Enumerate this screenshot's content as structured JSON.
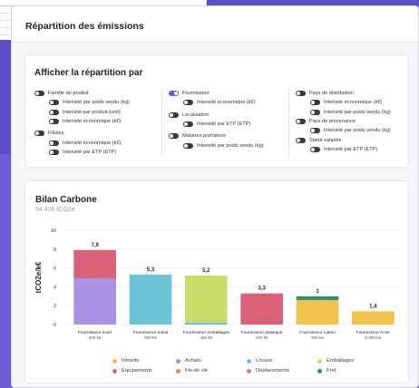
{
  "panel": {
    "title": "Répartition des émissions"
  },
  "filters": {
    "title": "Afficher la répartition par",
    "columns": [
      [
        {
          "label": "Famille de produit",
          "sub": false,
          "on": false
        },
        {
          "label": "Intensité par poids vendu (kg)",
          "sub": true,
          "on": false
        },
        {
          "label": "Intensité par produit (unit)",
          "sub": true,
          "on": false
        },
        {
          "label": "Intensité économique (k€)",
          "sub": true,
          "on": false
        },
        {
          "label": "Filiales",
          "sub": false,
          "on": false,
          "gap": true
        },
        {
          "label": "Intensité économique (k€)",
          "sub": true,
          "on": false
        },
        {
          "label": "Intensité par ETP (ETP)",
          "sub": true,
          "on": false
        }
      ],
      [
        {
          "label": "Fournisseur",
          "sub": false,
          "on": true
        },
        {
          "label": "Intensité économique (k€)",
          "sub": true,
          "on": false
        },
        {
          "label": "Localisation",
          "sub": false,
          "on": false,
          "gap": true
        },
        {
          "label": "Intensité par ETP (ETP)",
          "sub": true,
          "on": false
        },
        {
          "label": "Matières premières",
          "sub": false,
          "on": false,
          "gap": true
        },
        {
          "label": "Intensité par poids vendu (kg)",
          "sub": true,
          "on": false
        }
      ],
      [
        {
          "label": "Pays de distribution",
          "sub": false,
          "on": false
        },
        {
          "label": "Intensité économique (k€)",
          "sub": true,
          "on": false
        },
        {
          "label": "Intensité par poids vendu (kg)",
          "sub": true,
          "on": false
        },
        {
          "label": "Pays de provenance",
          "sub": false,
          "on": false
        },
        {
          "label": "Intensité par poids vendu (kg)",
          "sub": true,
          "on": false
        },
        {
          "label": "Statut salariés",
          "sub": false,
          "on": false
        },
        {
          "label": "Intensité par ETP (ETP)",
          "sub": true,
          "on": false
        }
      ]
    ]
  },
  "chart_card": {
    "title": "Bilan Carbone",
    "subtitle": "54 426 tCO2e"
  },
  "colors": {
    "Intrants": "#efc14d",
    "Achats": "#a991e6",
    "Locaux": "#6cc3d8",
    "Emballages": "#c9df6a",
    "Équipements": "#d9627a",
    "Fin de vie": "#e8873f",
    "Déplacements": "#d872b8",
    "Fret": "#2f8f6e"
  },
  "chart_data": {
    "type": "bar",
    "stacked": true,
    "ylabel": "tCO2e/k€",
    "ylim": [
      0,
      10
    ],
    "yticks": [
      0,
      2,
      4,
      6,
      8,
      10
    ],
    "grid": true,
    "legend_position": "bottom",
    "categories": [
      {
        "name": "Fournisseur acier",
        "sub": "300 k€",
        "total_label": "7,9"
      },
      {
        "name": "Fournisseur métal",
        "sub": "500 k€",
        "total_label": "5,3"
      },
      {
        "name": "Fournisseur emballages",
        "sub": "450 k€",
        "total_label": "5,2"
      },
      {
        "name": "Fournisseur plastique",
        "sub": "200 k€",
        "total_label": "3,3"
      },
      {
        "name": "Fournisseur Laiton",
        "sub": "900 k€",
        "total_label": "3"
      },
      {
        "name": "Fournisseur Acier",
        "sub": "6 000 k€",
        "total_label": "1,4"
      }
    ],
    "series": [
      {
        "name": "Intrants",
        "values": [
          0,
          0,
          0,
          0,
          2.6,
          1.4
        ]
      },
      {
        "name": "Achats",
        "values": [
          4.9,
          0,
          0,
          0,
          0,
          0
        ]
      },
      {
        "name": "Locaux",
        "values": [
          0,
          5.3,
          0.2,
          0,
          0,
          0
        ]
      },
      {
        "name": "Emballages",
        "values": [
          0,
          0,
          5.0,
          0,
          0,
          0
        ]
      },
      {
        "name": "Équipements",
        "values": [
          3.0,
          0,
          0,
          3.3,
          0,
          0
        ]
      },
      {
        "name": "Fin de vie",
        "values": [
          0,
          0,
          0,
          0,
          0,
          0
        ]
      },
      {
        "name": "Déplacements",
        "values": [
          0,
          0,
          0,
          0,
          0,
          0
        ]
      },
      {
        "name": "Fret",
        "values": [
          0,
          0,
          0,
          0,
          0.4,
          0
        ]
      }
    ]
  },
  "legend": [
    [
      "Intrants",
      "Achats",
      "Locaux",
      "Emballages"
    ],
    [
      "Équipements",
      "Fin de vie",
      "Déplacements",
      "Fret"
    ]
  ]
}
